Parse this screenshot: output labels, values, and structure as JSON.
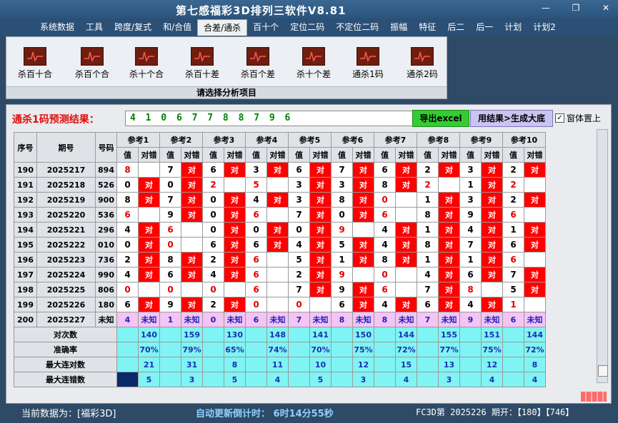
{
  "app_title": "第七感福彩3D排列三软件V8.81",
  "window_buttons": [
    "—",
    "❐",
    "✕"
  ],
  "menu": [
    "系统数据",
    "工具",
    "跨度/复式",
    "和/合值",
    "合差/通杀",
    "百十个",
    "定位二码",
    "不定位二码",
    "振幅",
    "特征",
    "后二",
    "后一",
    "计划",
    "计划2"
  ],
  "menu_active_index": 4,
  "ribbon": {
    "buttons": [
      "杀百十合",
      "杀百个合",
      "杀十个合",
      "杀百十差",
      "杀百个差",
      "杀十个差",
      "通杀1码",
      "通杀2码"
    ],
    "caption": "请选择分析项目"
  },
  "prediction": {
    "label": "通杀1码预测结果：",
    "value": "4 1 0 6 7 7 8 8 7 9 6",
    "export_button": "导出excel",
    "generate_button": "用结果>生成大底",
    "topmost_label": "窗体置上",
    "topmost_checked": "✓"
  },
  "table": {
    "col_seq": "序号",
    "col_issue": "期号",
    "col_code": "号码",
    "refs": [
      "参考1",
      "参考2",
      "参考3",
      "参考4",
      "参考5",
      "参考6",
      "参考7",
      "参考8",
      "参考9",
      "参考10"
    ],
    "sub_val": "值",
    "sub_check": "对错",
    "hit_text": "对",
    "unknown_text": "未知",
    "rows": [
      {
        "seq": "190",
        "issue": "2025217",
        "code": "894",
        "v": [
          8,
          7,
          6,
          3,
          6,
          7,
          6,
          2,
          3,
          2
        ],
        "h": [
          0,
          1,
          1,
          1,
          1,
          1,
          1,
          1,
          1,
          1
        ]
      },
      {
        "seq": "191",
        "issue": "2025218",
        "code": "526",
        "v": [
          0,
          0,
          2,
          5,
          3,
          3,
          8,
          2,
          1,
          2
        ],
        "h": [
          1,
          1,
          0,
          0,
          1,
          1,
          1,
          0,
          1,
          0
        ]
      },
      {
        "seq": "192",
        "issue": "2025219",
        "code": "900",
        "v": [
          8,
          7,
          0,
          4,
          3,
          8,
          0,
          1,
          3,
          2
        ],
        "h": [
          1,
          1,
          1,
          1,
          1,
          1,
          0,
          1,
          1,
          1
        ]
      },
      {
        "seq": "193",
        "issue": "2025220",
        "code": "536",
        "v": [
          6,
          9,
          0,
          6,
          7,
          0,
          6,
          8,
          9,
          6
        ],
        "h": [
          0,
          1,
          1,
          0,
          1,
          1,
          0,
          1,
          1,
          0
        ]
      },
      {
        "seq": "194",
        "issue": "2025221",
        "code": "296",
        "v": [
          4,
          6,
          0,
          0,
          0,
          9,
          4,
          1,
          4,
          1
        ],
        "h": [
          1,
          0,
          1,
          1,
          1,
          0,
          1,
          1,
          1,
          1
        ]
      },
      {
        "seq": "195",
        "issue": "2025222",
        "code": "010",
        "v": [
          0,
          0,
          6,
          6,
          4,
          5,
          4,
          8,
          7,
          6
        ],
        "h": [
          1,
          0,
          1,
          1,
          1,
          1,
          1,
          1,
          1,
          1
        ]
      },
      {
        "seq": "196",
        "issue": "2025223",
        "code": "736",
        "v": [
          2,
          8,
          2,
          6,
          5,
          1,
          8,
          1,
          1,
          6
        ],
        "h": [
          1,
          1,
          1,
          0,
          1,
          1,
          1,
          1,
          1,
          0
        ]
      },
      {
        "seq": "197",
        "issue": "2025224",
        "code": "990",
        "v": [
          4,
          6,
          4,
          6,
          2,
          9,
          0,
          4,
          6,
          7
        ],
        "h": [
          1,
          1,
          1,
          0,
          1,
          0,
          0,
          1,
          1,
          1
        ]
      },
      {
        "seq": "198",
        "issue": "2025225",
        "code": "806",
        "v": [
          0,
          0,
          0,
          6,
          7,
          9,
          6,
          7,
          8,
          5
        ],
        "h": [
          0,
          0,
          0,
          0,
          1,
          1,
          0,
          1,
          0,
          1
        ]
      },
      {
        "seq": "199",
        "issue": "2025226",
        "code": "180",
        "v": [
          6,
          9,
          2,
          0,
          0,
          6,
          4,
          6,
          4,
          1
        ],
        "h": [
          1,
          1,
          1,
          0,
          0,
          1,
          1,
          1,
          1,
          0
        ]
      }
    ],
    "pending": {
      "seq": "200",
      "issue": "2025227",
      "code": "未知",
      "v": [
        "4",
        "1",
        "0",
        "6",
        "7",
        "8",
        "8",
        "7",
        "9",
        "6"
      ]
    },
    "stats": [
      {
        "label": "对次数",
        "values": [
          "140",
          "159",
          "130",
          "148",
          "141",
          "150",
          "144",
          "155",
          "151",
          "144"
        ]
      },
      {
        "label": "准确率",
        "values": [
          "70%",
          "79%",
          "65%",
          "74%",
          "70%",
          "75%",
          "72%",
          "77%",
          "75%",
          "72%"
        ]
      },
      {
        "label": "最大连对数",
        "values": [
          "21",
          "31",
          "8",
          "11",
          "10",
          "12",
          "15",
          "13",
          "12",
          "8"
        ]
      },
      {
        "label": "最大连错数",
        "values": [
          "5",
          "3",
          "5",
          "4",
          "5",
          "3",
          "4",
          "3",
          "4",
          "4"
        ]
      }
    ]
  },
  "status": {
    "current_data": "当前数据为：[福彩3D]",
    "countdown": "自动更新倒计时：  6时14分55秒",
    "issue_info": "FC3D第 2025226 期开：【180】【746】"
  },
  "colors": {
    "hit": "#ff0000",
    "stat_bg": "#80f4f4",
    "unknown_bg": "#f4c4f4",
    "accent_green": "#33cc33"
  }
}
